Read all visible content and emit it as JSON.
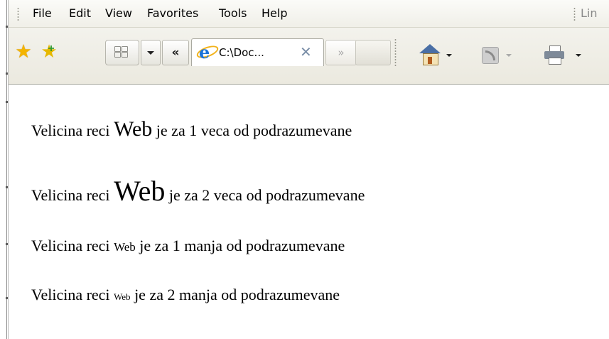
{
  "menu": {
    "file": "File",
    "edit": "Edit",
    "view": "View",
    "favorites": "Favorites",
    "tools": "Tools",
    "help": "Help",
    "links": "Lin"
  },
  "tabs": {
    "active_title": "C:\\Doc...",
    "close_symbol": "✕",
    "scroll_left_symbol": "«",
    "scroll_right_symbol": "»"
  },
  "icons": {
    "favorites": "star-icon",
    "add_favorites": "star-add-icon",
    "quick_tabs": "grid-icon",
    "tab_list": "chevron-down-icon",
    "home": "home-icon",
    "feeds": "feeds-icon",
    "print": "printer-icon"
  },
  "content": {
    "lines": [
      {
        "prefix": "Velicina reci ",
        "word": "Web",
        "suffix": " je za 1 veca od podrazumevane"
      },
      {
        "prefix": "Velicina reci ",
        "word": "Web",
        "suffix": " je za 2 veca od podrazumevane"
      },
      {
        "prefix": "Velicina reci ",
        "word": "Web",
        "suffix": " je za 1 manja od podrazumevane"
      },
      {
        "prefix": "Velicina reci ",
        "word": "Web",
        "suffix": " je za 2 manja od podrazumevane"
      }
    ]
  },
  "colors": {
    "background": "#ffffff",
    "chrome": "#f0efe8",
    "text": "#000000"
  }
}
